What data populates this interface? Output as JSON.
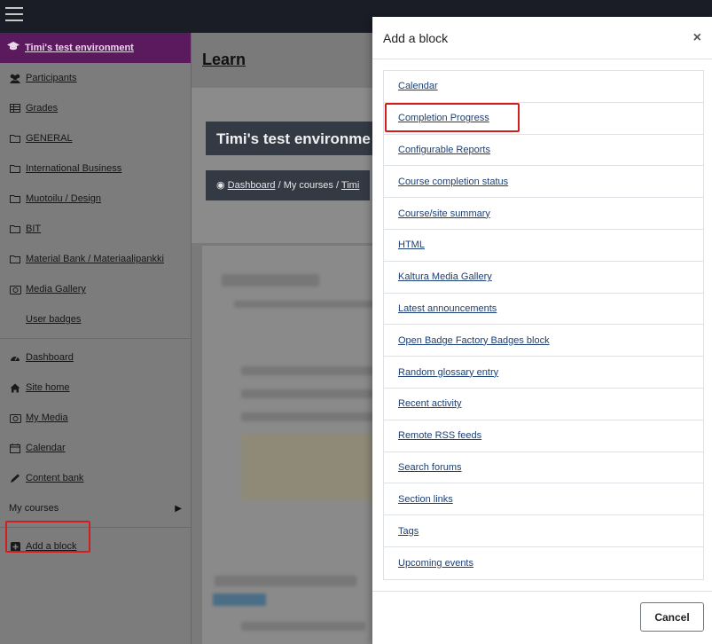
{
  "sidebar": {
    "course_title": "Timi's test environment",
    "items": [
      {
        "label": "Participants",
        "icon": "users-icon"
      },
      {
        "label": "Grades",
        "icon": "table-icon"
      },
      {
        "label": "GENERAL",
        "icon": "folder-icon"
      },
      {
        "label": "International Business",
        "icon": "folder-icon"
      },
      {
        "label": "Muotoilu / Design",
        "icon": "folder-icon"
      },
      {
        "label": "BIT",
        "icon": "folder-icon"
      },
      {
        "label": "Material Bank / Materiaalipankki",
        "icon": "folder-icon"
      },
      {
        "label": "Media Gallery",
        "icon": "media-icon"
      },
      {
        "label": "User badges",
        "icon": ""
      }
    ],
    "site_items": [
      {
        "label": "Dashboard",
        "icon": "dashboard-icon"
      },
      {
        "label": "Site home",
        "icon": "home-icon"
      },
      {
        "label": "My Media",
        "icon": "media-icon"
      },
      {
        "label": "Calendar",
        "icon": "calendar-icon"
      },
      {
        "label": "Content bank",
        "icon": "pencil-icon"
      }
    ],
    "my_courses": "My courses",
    "add_block": "Add a block"
  },
  "main": {
    "title": "Learn",
    "hero_title": "Timi's test environme",
    "breadcrumb": {
      "dashboard": "Dashboard",
      "sep": "/",
      "my_courses": "My courses",
      "current": "Timi"
    }
  },
  "modal": {
    "title": "Add a block",
    "close_glyph": "×",
    "blocks": [
      "Calendar",
      "Completion Progress",
      "Configurable Reports",
      "Course completion status",
      "Course/site summary",
      "HTML",
      "Kaltura Media Gallery",
      "Latest announcements",
      "Open Badge Factory Badges block",
      "Random glossary entry",
      "Recent activity",
      "Remote RSS feeds",
      "Search forums",
      "Section links",
      "Tags",
      "Upcoming events"
    ],
    "cancel_label": "Cancel"
  },
  "colors": {
    "course_header": "#5c1a5e",
    "highlight": "#d01e1e",
    "navbar": "#1a1d26",
    "link": "#1c3f73"
  }
}
